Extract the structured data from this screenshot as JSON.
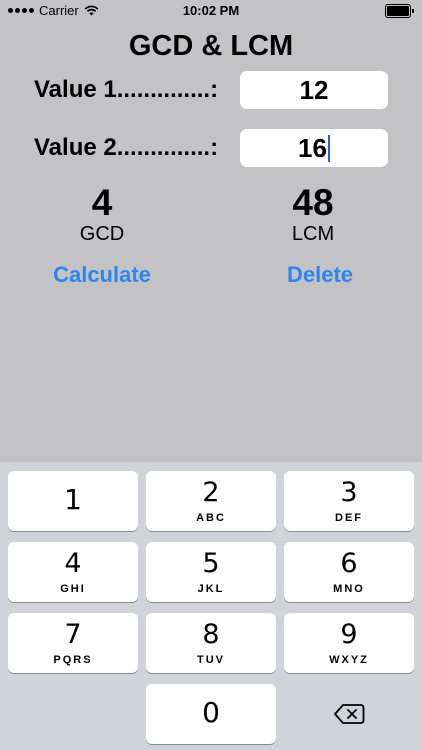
{
  "status_bar": {
    "carrier": "Carrier",
    "time": "10:02 PM"
  },
  "app": {
    "title": "GCD & LCM",
    "value1_label": "Value 1..............:",
    "value1": "12",
    "value2_label": "Value 2..............:",
    "value2": "16",
    "gcd_value": "4",
    "gcd_label": "GCD",
    "lcm_value": "48",
    "lcm_label": "LCM",
    "calculate_label": "Calculate",
    "delete_label": "Delete"
  },
  "keyboard": {
    "keys": [
      {
        "digit": "1",
        "letters": ""
      },
      {
        "digit": "2",
        "letters": "ABC"
      },
      {
        "digit": "3",
        "letters": "DEF"
      },
      {
        "digit": "4",
        "letters": "GHI"
      },
      {
        "digit": "5",
        "letters": "JKL"
      },
      {
        "digit": "6",
        "letters": "MNO"
      },
      {
        "digit": "7",
        "letters": "PQRS"
      },
      {
        "digit": "8",
        "letters": "TUV"
      },
      {
        "digit": "9",
        "letters": "WXYZ"
      },
      {
        "digit": "0",
        "letters": ""
      }
    ],
    "backspace_icon": "backspace-icon"
  },
  "colors": {
    "background": "#c3c3c5",
    "accent": "#2b86f1",
    "keyboard_background": "#d0d3d8",
    "caret": "#2a5bd7"
  }
}
